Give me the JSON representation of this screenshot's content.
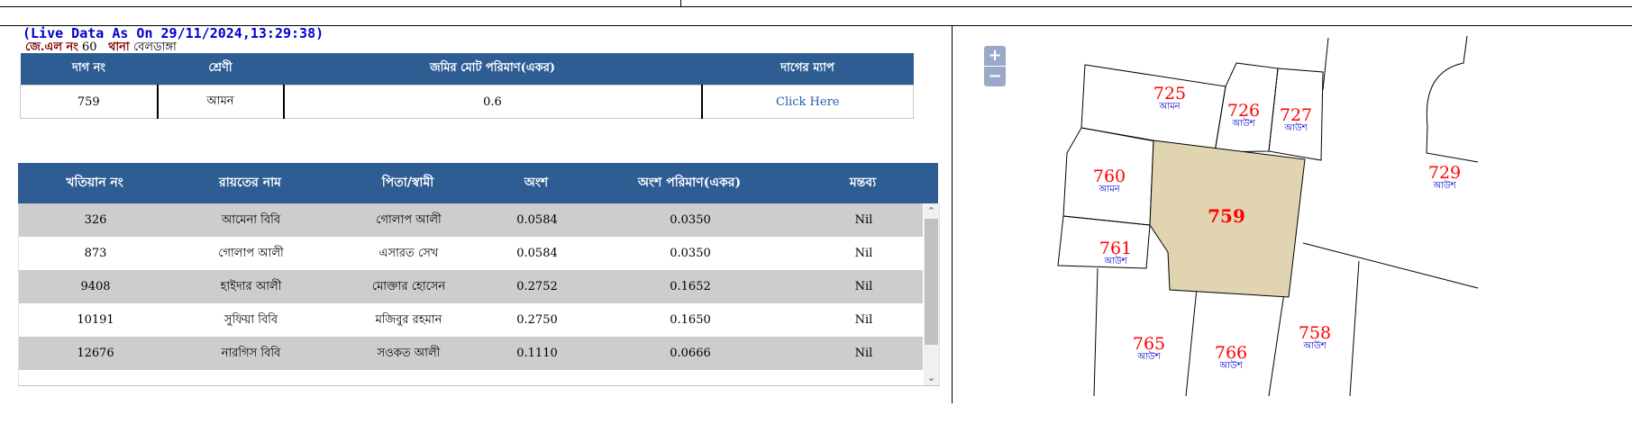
{
  "live_data": "(Live Data As On 29/11/2024,13:29:38)",
  "jl": {
    "jl_label": "জে.এল নং",
    "jl_value": "60",
    "thana_label": "থানা",
    "thana_value": "বেলডাঙ্গা"
  },
  "dag_table": {
    "headers": [
      "দাগ নং",
      "শ্রেণী",
      "জমির মোট পরিমাণ(একর)",
      "দাগের ম্যাপ"
    ],
    "row": {
      "dag_no": "759",
      "class": "আমন",
      "area": "0.6",
      "map_link": "Click Here"
    }
  },
  "khatian_table": {
    "headers": [
      "খতিয়ান নং",
      "রায়তের নাম",
      "পিতা/স্বামী",
      "অংশ",
      "অংশ পরিমাণ(একর)",
      "মন্তব্য"
    ],
    "rows": [
      {
        "khatian": "326",
        "name": "আমেনা বিবি",
        "father": "গোলাপ আলী",
        "share": "0.0584",
        "share_area": "0.0350",
        "remark": "Nil"
      },
      {
        "khatian": "873",
        "name": "গোলাপ আলী",
        "father": "এসারত সেখ",
        "share": "0.0584",
        "share_area": "0.0350",
        "remark": "Nil"
      },
      {
        "khatian": "9408",
        "name": "হাইদার আলী",
        "father": "মোক্তার হোসেন",
        "share": "0.2752",
        "share_area": "0.1652",
        "remark": "Nil"
      },
      {
        "khatian": "10191",
        "name": "সুফিয়া বিবি",
        "father": "মজিবুর রহমান",
        "share": "0.2750",
        "share_area": "0.1650",
        "remark": "Nil"
      },
      {
        "khatian": "12676",
        "name": "নারগিস বিবি",
        "father": "সওকত আলী",
        "share": "0.1110",
        "share_area": "0.0666",
        "remark": "Nil"
      }
    ]
  },
  "map": {
    "zoom_in": "+",
    "zoom_out": "−",
    "selected_plot": "759",
    "selected_fill": "#e0d5b0",
    "plot_number_color": "#ff0000",
    "plot_class_color": "#0000cc",
    "plots": [
      {
        "no": "725",
        "class": "আমন"
      },
      {
        "no": "726",
        "class": "আউশ"
      },
      {
        "no": "727",
        "class": "আউশ"
      },
      {
        "no": "760",
        "class": "আমন"
      },
      {
        "no": "729",
        "class": "আউশ"
      },
      {
        "no": "761",
        "class": "আউশ"
      },
      {
        "no": "765",
        "class": "আউশ"
      },
      {
        "no": "766",
        "class": "আউশ"
      },
      {
        "no": "758",
        "class": "আউশ"
      }
    ]
  },
  "icons": {
    "scroll_up": "chevron-up-icon",
    "scroll_down": "chevron-down-icon"
  }
}
